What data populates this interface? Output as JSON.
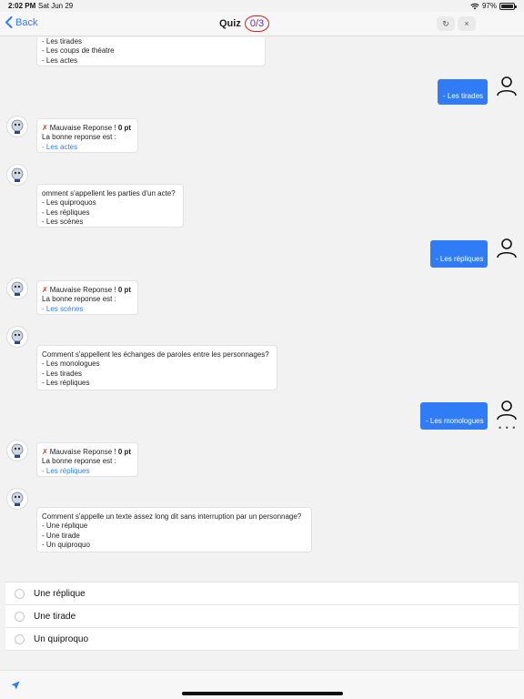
{
  "status_bar": {
    "time": "2:02 PM",
    "date": "Sat Jun 29",
    "battery": "97%",
    "battery_level": 0.97
  },
  "nav": {
    "back_label": "Back",
    "title": "Quiz",
    "score": "0/3",
    "refresh_icon": "refresh-icon",
    "close_icon": "close-icon",
    "close_symbol": "×",
    "refresh_symbol": "↻"
  },
  "messages": {
    "partial_question": {
      "lines": [
        "- Les tirades",
        "- Les coups de théatre",
        "- Les actes"
      ]
    },
    "reply1": {
      "text": "- Les tirades"
    },
    "feedback1": {
      "title": "Mauvaise Reponse !",
      "points": "0 pt",
      "intro": "La bonne reponse est :",
      "answer": "- Les actes"
    },
    "question2": {
      "lines": [
        "omment s'appellent les parties d'un acte?",
        "- Les quiproquos",
        "- Les répliques",
        "- Les scènes"
      ]
    },
    "reply2": {
      "text": "- Les répliques"
    },
    "feedback2": {
      "title": "Mauvaise Reponse !",
      "points": "0 pt",
      "intro": "La bonne reponse est :",
      "answer": "- Les scènes"
    },
    "question3": {
      "lines": [
        "Comment s'appellent les échanges de paroles entre les personnages?",
        "- Les monologues",
        "- Les tirades",
        "- Les répliques"
      ]
    },
    "reply3": {
      "text": "- Les monologues"
    },
    "feedback3": {
      "title": "Mauvaise Reponse !",
      "points": "0 pt",
      "intro": "La bonne reponse est :",
      "answer": "- Les répliques"
    },
    "question4": {
      "lines": [
        "Comment s'appelle un texte assez long dit sans interruption par un personnage?",
        "- Une réplique",
        "- Une tirade",
        "- Un quiproquo"
      ]
    },
    "typing": "• • •",
    "wrong_symbol": "✗"
  },
  "answers": [
    {
      "label": "Une réplique"
    },
    {
      "label": "Une tirade"
    },
    {
      "label": "Un quiproquo"
    }
  ],
  "colors": {
    "accent": "#2f7cf6",
    "score_ring": "#e02020",
    "score_text": "#6b2f9f",
    "error": "#d23030"
  }
}
